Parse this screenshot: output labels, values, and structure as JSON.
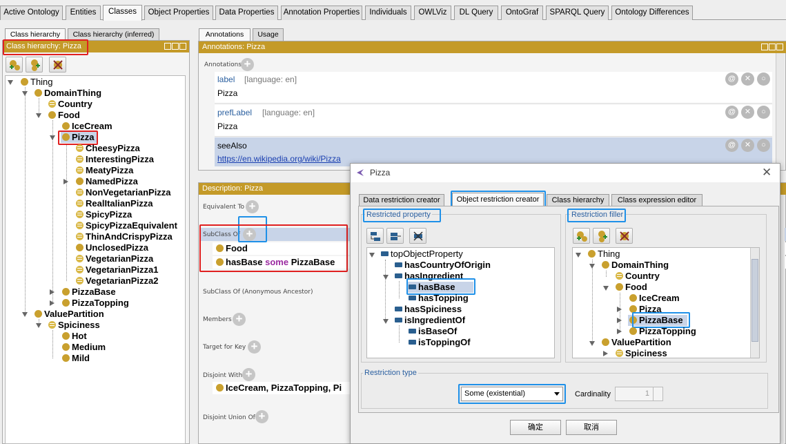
{
  "tabs": [
    "Active Ontology",
    "Entities",
    "Classes",
    "Object Properties",
    "Data Properties",
    "Annotation Properties",
    "Individuals",
    "OWLViz",
    "DL Query",
    "OntoGraf",
    "SPARQL Query",
    "Ontology Differences"
  ],
  "left": {
    "subtabs": [
      "Class hierarchy",
      "Class hierarchy (inferred)"
    ],
    "header": "Class hierarchy: Pizza",
    "tree": [
      {
        "label": "Thing"
      },
      {
        "label": "DomainThing"
      },
      {
        "label": "Country"
      },
      {
        "label": "Food"
      },
      {
        "label": "IceCream"
      },
      {
        "label": "Pizza"
      },
      {
        "label": "CheesyPizza"
      },
      {
        "label": "InterestingPizza"
      },
      {
        "label": "MeatyPizza"
      },
      {
        "label": "NamedPizza"
      },
      {
        "label": "NonVegetarianPizza"
      },
      {
        "label": "RealItalianPizza"
      },
      {
        "label": "SpicyPizza"
      },
      {
        "label": "SpicyPizzaEquivalent"
      },
      {
        "label": "ThinAndCrispyPizza"
      },
      {
        "label": "UnclosedPizza"
      },
      {
        "label": "VegetarianPizza"
      },
      {
        "label": "VegetarianPizza1"
      },
      {
        "label": "VegetarianPizza2"
      },
      {
        "label": "PizzaBase"
      },
      {
        "label": "PizzaTopping"
      },
      {
        "label": "ValuePartition"
      },
      {
        "label": "Spiciness"
      },
      {
        "label": "Hot"
      },
      {
        "label": "Medium"
      },
      {
        "label": "Mild"
      }
    ]
  },
  "ann": {
    "subtabs": [
      "Annotations",
      "Usage"
    ],
    "header": "Annotations: Pizza",
    "section": "Annotations",
    "rows": [
      {
        "prop": "label",
        "lang": "[language: en]",
        "value": "Pizza"
      },
      {
        "prop": "prefLabel",
        "lang": "[language: en]",
        "value": "Pizza"
      },
      {
        "prop": "seeAlso",
        "lang": "",
        "value": "https://en.wikipedia.org/wiki/Pizza"
      }
    ]
  },
  "desc": {
    "header": "Description: Pizza",
    "equivalent": "Equivalent To",
    "subclass": "SubClass Of",
    "sub1": "Food",
    "sub2_a": "hasBase",
    "sub2_kw": "some",
    "sub2_b": "PizzaBase",
    "anon": "SubClass Of (Anonymous Ancestor)",
    "members": "Members",
    "target": "Target for Key",
    "disjoint": "Disjoint With",
    "disjoint_val": "IceCream, PizzaTopping, Pi",
    "disjoint_union": "Disjoint Union Of"
  },
  "dialog": {
    "title": "Pizza",
    "tabs": [
      "Data restriction creator",
      "Object restriction creator",
      "Class hierarchy",
      "Class expression editor"
    ],
    "restricted_property": "Restricted property",
    "restriction_filler": "Restriction filler",
    "props": [
      "topObjectProperty",
      "hasCountryOfOrigin",
      "hasIngredient",
      "hasBase",
      "hasTopping",
      "hasSpiciness",
      "isIngredientOf",
      "isBaseOf",
      "isToppingOf"
    ],
    "filler": [
      "Thing",
      "DomainThing",
      "Country",
      "Food",
      "IceCream",
      "Pizza",
      "PizzaBase",
      "PizzaTopping",
      "ValuePartition",
      "Spiciness"
    ],
    "restriction_type_label": "Restriction type",
    "restriction_type": "Some (existential)",
    "cardinality_label": "Cardinality",
    "cardinality": "1",
    "ok": "确定",
    "cancel": "取消"
  }
}
